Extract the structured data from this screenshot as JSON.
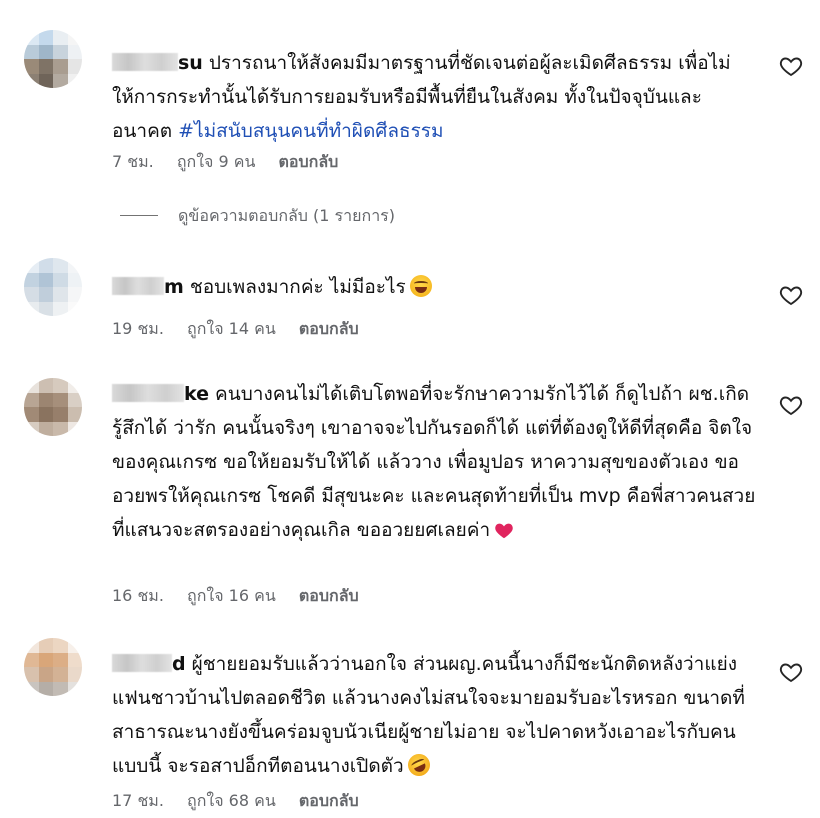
{
  "comments": [
    {
      "username_visible": "su",
      "text_parts": [
        "ปรารถนาให้สังคมมีมาตรฐานที่ชัดเจนต่อผู้ละเมิดศีลธรรม เพื่อไม่ให้การกระทำนั้นได้รับการยอมรับหรือมีพื้นที่ยืนในสังคม ทั้งในปัจจุบันและอนาคต "
      ],
      "hashtag": "#ไม่สนับสนุนคนที่ทำผิดศีลธรรม",
      "time": "7 ชม.",
      "likes": "ถูกใจ 9 คน",
      "reply": "ตอบกลับ",
      "avatar_colors": [
        "#dbe8f3",
        "#c4d9ec",
        "#e9eef2",
        "#f5f5f5",
        "#b9cbd9",
        "#9fb6c9",
        "#c8d3dc",
        "#eef1f4",
        "#9a8a78",
        "#7f7366",
        "#a99d90",
        "#e5e5e5",
        "#8c8073",
        "#6f6459",
        "#b3aaa0",
        "#f0f0f0"
      ]
    },
    {
      "username_visible": "m",
      "text_parts": [
        "ชอบเพลงมากค่ะ ไม่มีอะไร"
      ],
      "emoji": "laughing-emoji",
      "time": "19 ชม.",
      "likes": "ถูกใจ 14 คน",
      "reply": "ตอบกลับ",
      "avatar_colors": [
        "#e6edf4",
        "#d1dde9",
        "#dfe7ee",
        "#f3f5f7",
        "#c2d2e0",
        "#b0c4d6",
        "#cfdbe5",
        "#eef2f5",
        "#d5dde5",
        "#c0cedb",
        "#dfe5ea",
        "#f5f6f7",
        "#e8ecef",
        "#d9e0e6",
        "#eef1f3",
        "#fafafa"
      ]
    },
    {
      "username_visible": "ke",
      "text_parts": [
        "คนบางคนไม่ได้เติบโตพอที่จะรักษาความรักไว้ได้ ก็ดูไปถ้า ผช.เกิด รู้สึกได้ ว่ารัก คนนั้นจริงๆ เขาอาจจะไปกันรอดก็ได้ แต่ที่ต้องดูให้ดีที่สุดคือ จิตใจของคุณเกรซ ขอให้ยอมรับให้ได้ แล้ววาง เพื่อมูปอร หาความสุขของตัวเอง ขออวยพรให้คุณเกรซ โชคดี มีสุขนะคะ และคนสุดท้ายที่เป็น mvp คือพี่สาวคนสวยที่แสนวจะสตรองอย่างคุณเกิล ขออวยยศเลยค่า"
      ],
      "emoji": "red-heart-emoji",
      "time": "16 ชม.",
      "likes": "ถูกใจ 16 คน",
      "reply": "ตอบกลับ",
      "avatar_colors": [
        "#e8e2dc",
        "#cdbfb2",
        "#d6cabe",
        "#f1ede9",
        "#b8a594",
        "#9c8571",
        "#a68f7b",
        "#d9cfc5",
        "#a18a76",
        "#8a735f",
        "#977f6b",
        "#cbbdaf",
        "#d7ccc1",
        "#bfae9e",
        "#c9b9aa",
        "#eee8e3"
      ]
    },
    {
      "username_visible": "d",
      "text_parts": [
        "ผู้ชายยอมรับแล้วว่านอกใจ ส่วนผญ.คนนี้นางก็มีชะนักติดหลังว่าแย่งแฟนชาวบ้านไปตลอดชีวิต แล้วนางคงไม่สนใจจะมายอมรับอะไรหรอก ขนาดที่สาธารณะนางยังขึ้นคร่อมจูบนัวเนียผู้ชายไม่อาย จะไปคาดหวังเอาอะไรกับคนแบบนี้ จะรอสาปอ็กทีตอนนางเปิดตัว"
      ],
      "emoji": "rofl-emoji",
      "time": "17 ชม.",
      "likes": "ถูกใจ 68 คน",
      "reply": "ตอบกลับ",
      "avatar_colors": [
        "#f2e6dc",
        "#e6cdb7",
        "#ecd6c2",
        "#f7f0ea",
        "#e0b895",
        "#d9a679",
        "#dcae86",
        "#efdccb",
        "#d8c1ad",
        "#c9a587",
        "#d3b295",
        "#ead9ca",
        "#c9c4bf",
        "#b5aea7",
        "#c2bbb4",
        "#e4e1de"
      ]
    }
  ],
  "view_replies": "ดูข้อความตอบกลับ (1 รายการ)",
  "colors": {
    "meta_text": "#65676b",
    "hashtag": "#1f4fb5",
    "heart_emoji": "#e0245e"
  }
}
